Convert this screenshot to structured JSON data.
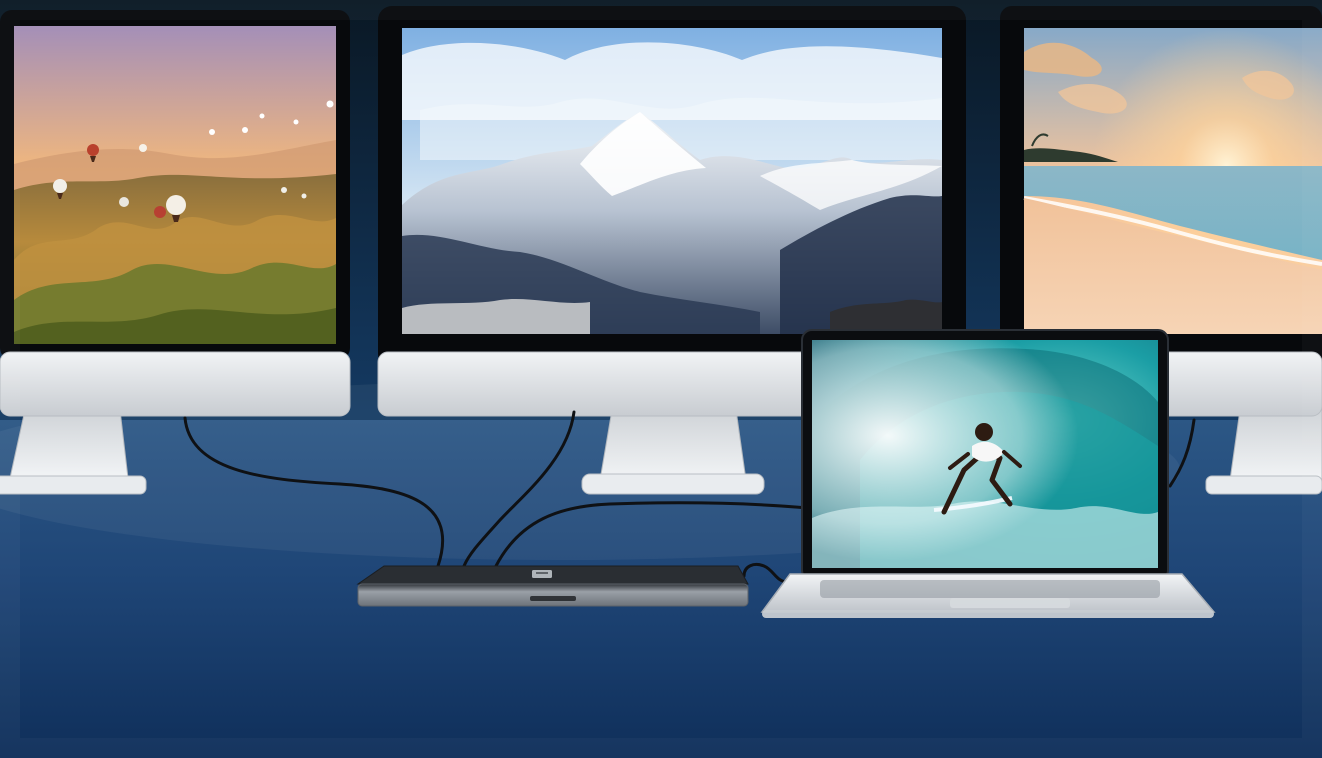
{
  "scene": {
    "background_top": "#0b1d2c",
    "background_bottom": "#0f2f5a",
    "desk_top": "#274f7c",
    "monitor_bezel": "#07090c",
    "monitor_chin": "#d9dde1",
    "stand": "#e3e6e9",
    "dock_body": "#8a8f96",
    "laptop_body": "#dfe2e6",
    "cable": "#121416"
  },
  "screens": [
    {
      "name": "left-monitor",
      "content": "hot-air-balloons-canyon-sunset"
    },
    {
      "name": "center-monitor",
      "content": "snowy-mountain-peak"
    },
    {
      "name": "right-monitor",
      "content": "beach-sunset"
    },
    {
      "name": "laptop",
      "content": "surfer-in-wave"
    }
  ],
  "icons": {
    "dock_logo": "dock-logo-icon"
  }
}
